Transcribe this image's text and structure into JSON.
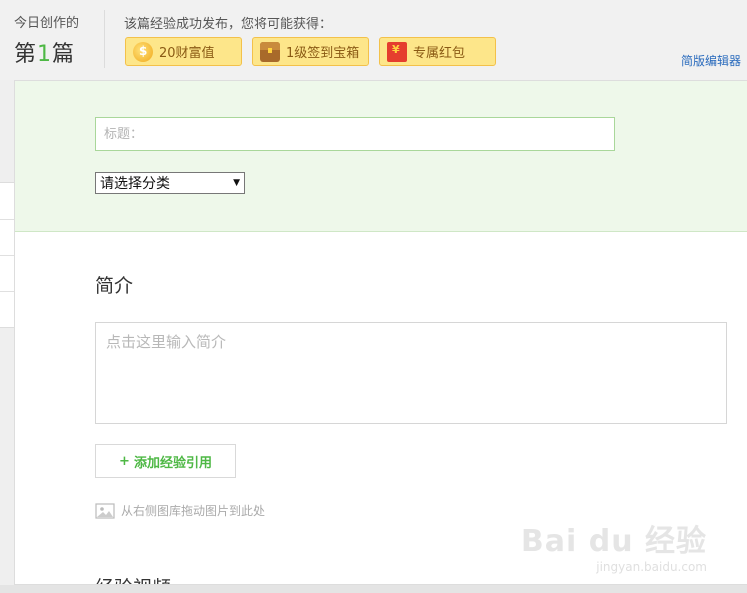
{
  "header": {
    "today_label": "今日创作的",
    "today_prefix": "第",
    "today_number": "1",
    "today_suffix": "篇",
    "reward_title": "该篇经验成功发布，您将可能获得：",
    "rewards": [
      {
        "label": "20财富值",
        "icon": "coin-icon"
      },
      {
        "label": "1级签到宝箱",
        "icon": "treasure-chest-icon"
      },
      {
        "label": "专属红包",
        "icon": "red-envelope-icon"
      }
    ],
    "simple_editor_label": "简版编辑器"
  },
  "form": {
    "title_placeholder": "标题：",
    "category_selected": "请选择分类",
    "intro_heading": "简介",
    "intro_placeholder": "点击这里输入简介",
    "add_reference_label": "添加经验引用",
    "add_reference_plus": "+",
    "drag_hint": "从右侧图库拖动图片到此处",
    "video_heading": "经验视频"
  },
  "watermark": {
    "logo": "Bai du 经验",
    "url": "jingyan.baidu.com"
  },
  "colors": {
    "accent_green": "#4eb845",
    "link_blue": "#2a6bbd",
    "badge_bg": "#fde68a",
    "panel_green": "#eef8ea"
  }
}
